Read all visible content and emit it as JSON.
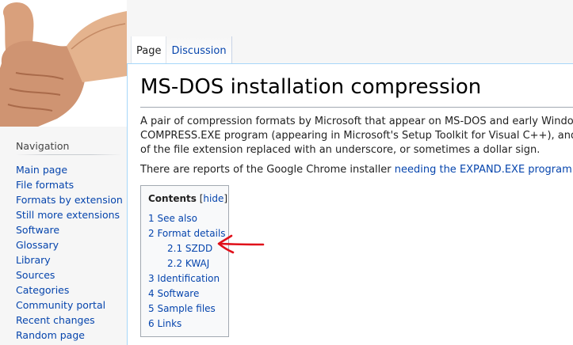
{
  "tabs": [
    {
      "label": "Page",
      "selected": true
    },
    {
      "label": "Discussion",
      "selected": false
    }
  ],
  "sidebar": {
    "heading": "Navigation",
    "items": [
      {
        "label": "Main page"
      },
      {
        "label": "File formats"
      },
      {
        "label": "Formats by extension"
      },
      {
        "label": "Still more extensions"
      },
      {
        "label": "Software"
      },
      {
        "label": "Glossary"
      },
      {
        "label": "Library"
      },
      {
        "label": "Sources"
      },
      {
        "label": "Categories"
      },
      {
        "label": "Community portal"
      },
      {
        "label": "Recent changes"
      },
      {
        "label": "Random page"
      }
    ]
  },
  "article": {
    "title": "MS-DOS installation compression",
    "para1_lines": [
      "A pair of compression formats by Microsoft that appear on MS-DOS and early Windows (",
      "COMPRESS.EXE program (appearing in Microsoft's Setup Toolkit for Visual C++), and unc",
      "of the file extension replaced with an underscore, or sometimes a dollar sign."
    ],
    "para2_prefix": "There are reports of the Google Chrome installer ",
    "para2_link": "needing the EXPAND.EXE program",
    "para2_suffix": "."
  },
  "toc": {
    "title": "Contents",
    "hide_open": "[",
    "hide_label": "hide",
    "hide_close": "]",
    "items": [
      {
        "label": "1 See also",
        "level": 1
      },
      {
        "label": "2 Format details",
        "level": 1
      },
      {
        "label": "2.1 SZDD",
        "level": 2
      },
      {
        "label": "2.2 KWAJ",
        "level": 2
      },
      {
        "label": "3 Identification",
        "level": 1
      },
      {
        "label": "4 Software",
        "level": 1
      },
      {
        "label": "5 Sample files",
        "level": 1
      },
      {
        "label": "6 Links",
        "level": 1
      }
    ]
  },
  "colors": {
    "link": "#0645ad",
    "annotation_arrow": "#e0101a",
    "content_border": "#a7d7f9"
  },
  "icons": {
    "logo": "thumbs-up-hand-icon",
    "external_link": "external-link-icon",
    "annotation": "red-arrow-icon"
  }
}
